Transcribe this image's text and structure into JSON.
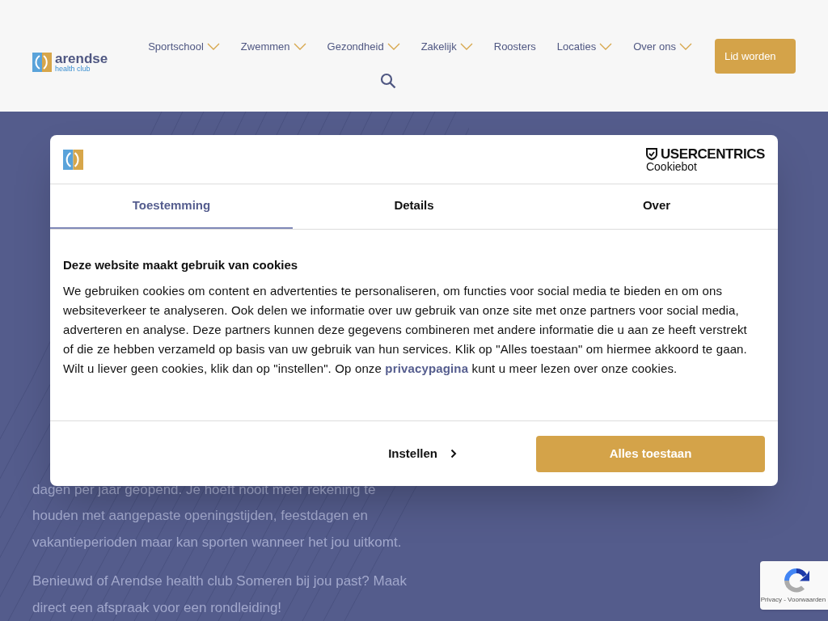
{
  "header": {
    "logo": {
      "name": "arendse",
      "tagline": "health club"
    },
    "nav": [
      {
        "label": "Sportschool",
        "dropdown": true
      },
      {
        "label": "Zwemmen",
        "dropdown": true
      },
      {
        "label": "Gezondheid",
        "dropdown": true
      },
      {
        "label": "Zakelijk",
        "dropdown": true
      },
      {
        "label": "Roosters",
        "dropdown": false
      },
      {
        "label": "Locaties",
        "dropdown": true
      },
      {
        "label": "Over ons",
        "dropdown": true
      }
    ],
    "cta": "Lid worden"
  },
  "background": {
    "paragraph_lines": [
      "dagen per jaar geopend. Je hoeft nooit meer rekening te",
      "houden met aangepaste openingstijden, feestdagen en",
      "vakantieperioden maar kan sporten wanneer het jou uitkomt."
    ],
    "paragraph2_lines": [
      "Benieuwd of Arendse health club Someren bij jou past? Maak",
      "direct een afspraak voor een rondleiding!"
    ]
  },
  "cookie_dialog": {
    "brand": "USERCENTRICS",
    "product": "Cookiebot",
    "tabs": [
      {
        "label": "Toestemming",
        "selected": true
      },
      {
        "label": "Details",
        "selected": false
      },
      {
        "label": "Over",
        "selected": false
      }
    ],
    "title": "Deze website maakt gebruik van cookies",
    "body": "We gebruiken cookies om content en advertenties te personaliseren, om functies voor social media te bieden en om ons websiteverkeer te analyseren. Ook delen we informatie over uw gebruik van onze site met onze partners voor social media, adverteren en analyse. Deze partners kunnen deze gegevens combineren met andere informatie die u aan ze heeft verstrekt of die ze hebben verzameld op basis van uw gebruik van hun services. Klik op \"Alles toestaan\" om hiermee akkoord te gaan. Wilt u liever geen cookies, klik dan op \"instellen\". Op onze ",
    "link": "privacypagina",
    "body_end": " kunt u meer lezen over onze cookies.",
    "settings_button": "Instellen",
    "accept_button": "Alles toestaan"
  },
  "recaptcha": {
    "label": "Privacy - Voorwaarden"
  }
}
